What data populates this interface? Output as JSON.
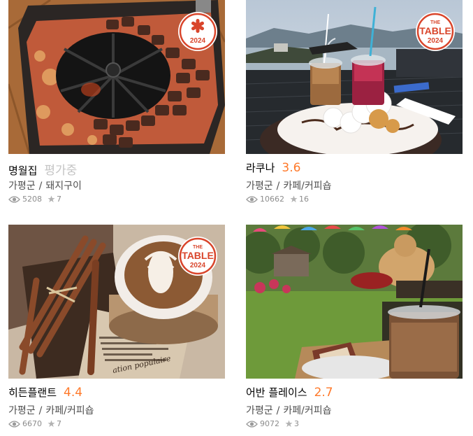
{
  "restaurants": [
    {
      "name": "명월집",
      "score": "평가중",
      "score_pending": true,
      "region": "가평군",
      "separator": "/",
      "category": "돼지구이",
      "views": "5208",
      "reviews": "7",
      "badge": {
        "type": "mark",
        "icon": "asterisk-icon",
        "year": "2024"
      }
    },
    {
      "name": "라쿠나",
      "score": "3.6",
      "score_pending": false,
      "region": "가평군",
      "separator": "/",
      "category": "카페/커피숍",
      "views": "10662",
      "reviews": "16",
      "badge": {
        "type": "table",
        "label": "TABLE",
        "prefix": "THE",
        "year": "2024"
      }
    },
    {
      "name": "히든플랜트",
      "score": "4.4",
      "score_pending": false,
      "region": "가평군",
      "separator": "/",
      "category": "카페/커피숍",
      "views": "6670",
      "reviews": "7",
      "badge": {
        "type": "table",
        "label": "TABLE",
        "prefix": "THE",
        "year": "2024"
      }
    },
    {
      "name": "어반 플레이스",
      "score": "2.7",
      "score_pending": false,
      "region": "가평군",
      "separator": "/",
      "category": "카페/커피숍",
      "views": "9072",
      "reviews": "3",
      "badge": null
    }
  ],
  "photo_text": {
    "newspaper": "ation populaire"
  },
  "colors": {
    "score": "#ff792a",
    "pending": "#c4c4c4",
    "badge_red": "#d9452b"
  }
}
